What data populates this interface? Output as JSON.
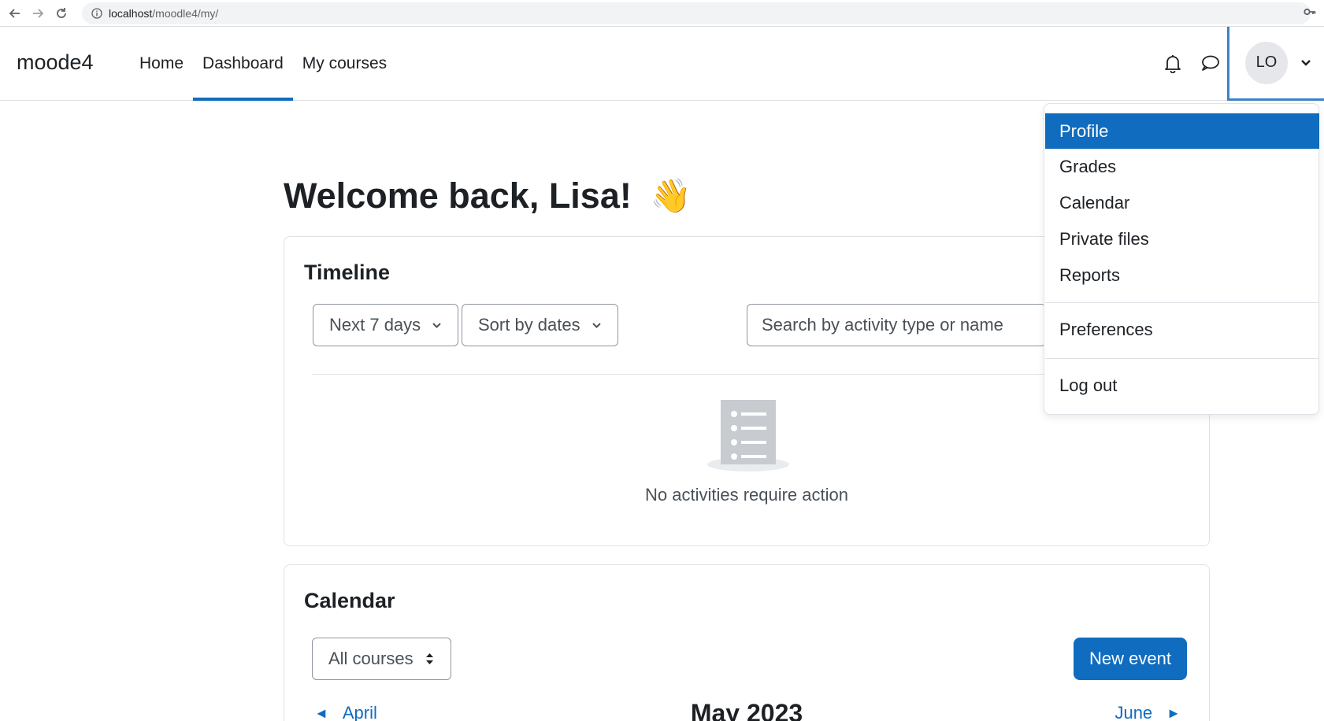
{
  "browser": {
    "url_host": "localhost",
    "url_path": "/moodle4/my/"
  },
  "navbar": {
    "brand": "moode4",
    "items": [
      {
        "label": "Home"
      },
      {
        "label": "Dashboard"
      },
      {
        "label": "My courses"
      }
    ],
    "active": "Dashboard",
    "user_initials": "LO"
  },
  "main": {
    "welcome": "Welcome back, Lisa!",
    "welcome_emoji": "👋"
  },
  "timeline": {
    "title": "Timeline",
    "day_filter": "Next 7 days",
    "sort_filter": "Sort by dates",
    "search_placeholder": "Search by activity type or name",
    "empty_message": "No activities require action"
  },
  "calendar": {
    "title": "Calendar",
    "course_filter": "All courses",
    "new_event_label": "New event",
    "prev_month": "April",
    "current_month": "May 2023",
    "next_month": "June"
  },
  "user_menu": {
    "items": [
      "Profile",
      "Grades",
      "Calendar",
      "Private files",
      "Reports"
    ],
    "preferences": "Preferences",
    "logout": "Log out",
    "highlighted": "Profile"
  },
  "colors": {
    "primary": "#0f6cbf",
    "focus_outline": "#3d82c4",
    "text": "#1d2125",
    "muted": "#495057"
  }
}
